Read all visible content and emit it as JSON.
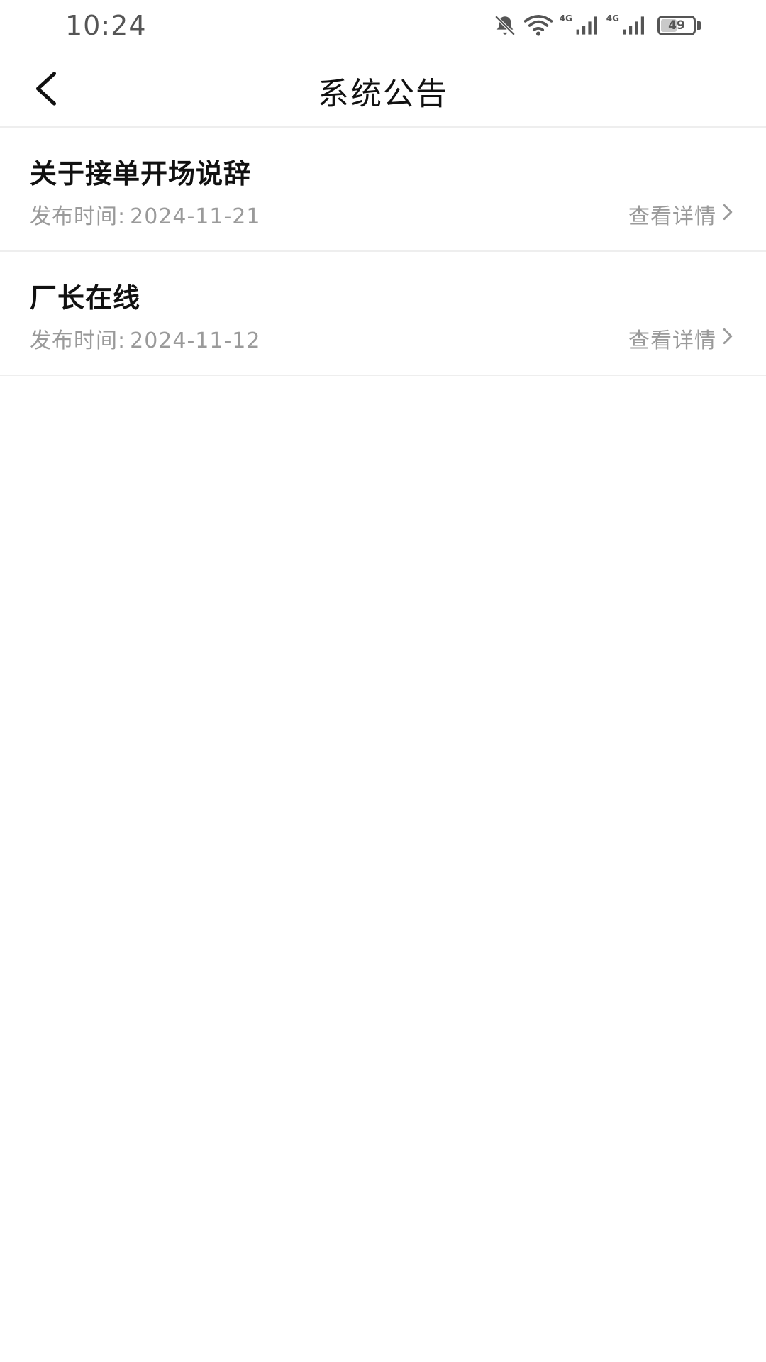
{
  "status_bar": {
    "time": "10:24",
    "network_1": "4G",
    "network_2": "4G",
    "battery": "49",
    "battery_level": 0.49,
    "icons": [
      "bell-muted-icon",
      "wifi-icon",
      "signal-icon",
      "signal-icon",
      "battery-icon"
    ]
  },
  "header": {
    "title": "系统公告",
    "back_icon": "chevron-left-icon"
  },
  "notices": [
    {
      "title": "关于接单开场说辞",
      "date_label": "发布时间:",
      "date": "2024-11-21",
      "detail_label": "查看详情"
    },
    {
      "title": "厂长在线",
      "date_label": "发布时间:",
      "date": "2024-11-12",
      "detail_label": "查看详情"
    }
  ],
  "colors": {
    "title": "#111111",
    "secondary": "#9a9a9a",
    "divider": "#eeeeee",
    "background": "#ffffff"
  }
}
